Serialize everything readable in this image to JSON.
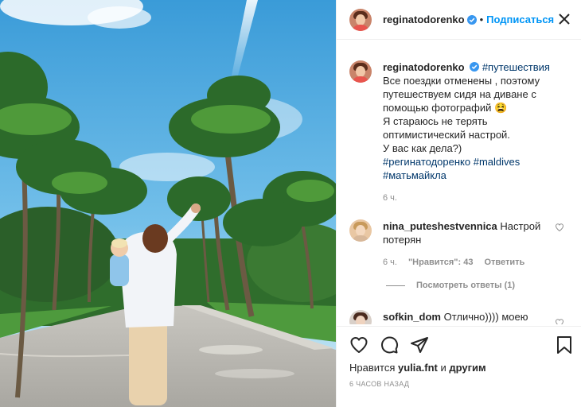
{
  "post": {
    "author": "reginatodorenko",
    "follow_label": "Подписаться",
    "dot": "•",
    "icons": {
      "verified": "verified-badge-icon",
      "close": "close-icon",
      "like": "heart-icon",
      "comment": "comment-icon",
      "share": "share-icon",
      "save": "bookmark-icon"
    },
    "colors": {
      "accent": "#0095f6",
      "hashtag": "#00376b",
      "muted": "#8e8e8e"
    }
  },
  "caption": {
    "username": "reginatodorenko",
    "hashtag_1": "#путешествия",
    "lines": [
      "Все поездки отменены , поэтому",
      "путешествуем сидя на диване с",
      "помощью фотографий 😫",
      "Я стараюсь не терять",
      "оптимистический настрой.",
      "У вас как дела?)"
    ],
    "hashtags_line1_a": "#регинатодоренко",
    "hashtags_line1_b": "#maldives",
    "hashtags_line2": "#матьмайкла",
    "time": "6 ч."
  },
  "comments": [
    {
      "username": "nina_puteshestvennica",
      "text": "Настрой потерян",
      "time": "6 ч.",
      "likes": "\"Нравится\": 43",
      "reply": "Ответить",
      "view_replies": "Посмотреть ответы (1)"
    },
    {
      "username": "sofkin_dom",
      "text": "Отлично)))) моею"
    }
  ],
  "footer": {
    "liked_prefix": "Нравится",
    "liked_user": "yulia.fnt",
    "liked_and": "и",
    "liked_others": "другим",
    "ago": "6 ЧАСОВ НАЗАД"
  }
}
